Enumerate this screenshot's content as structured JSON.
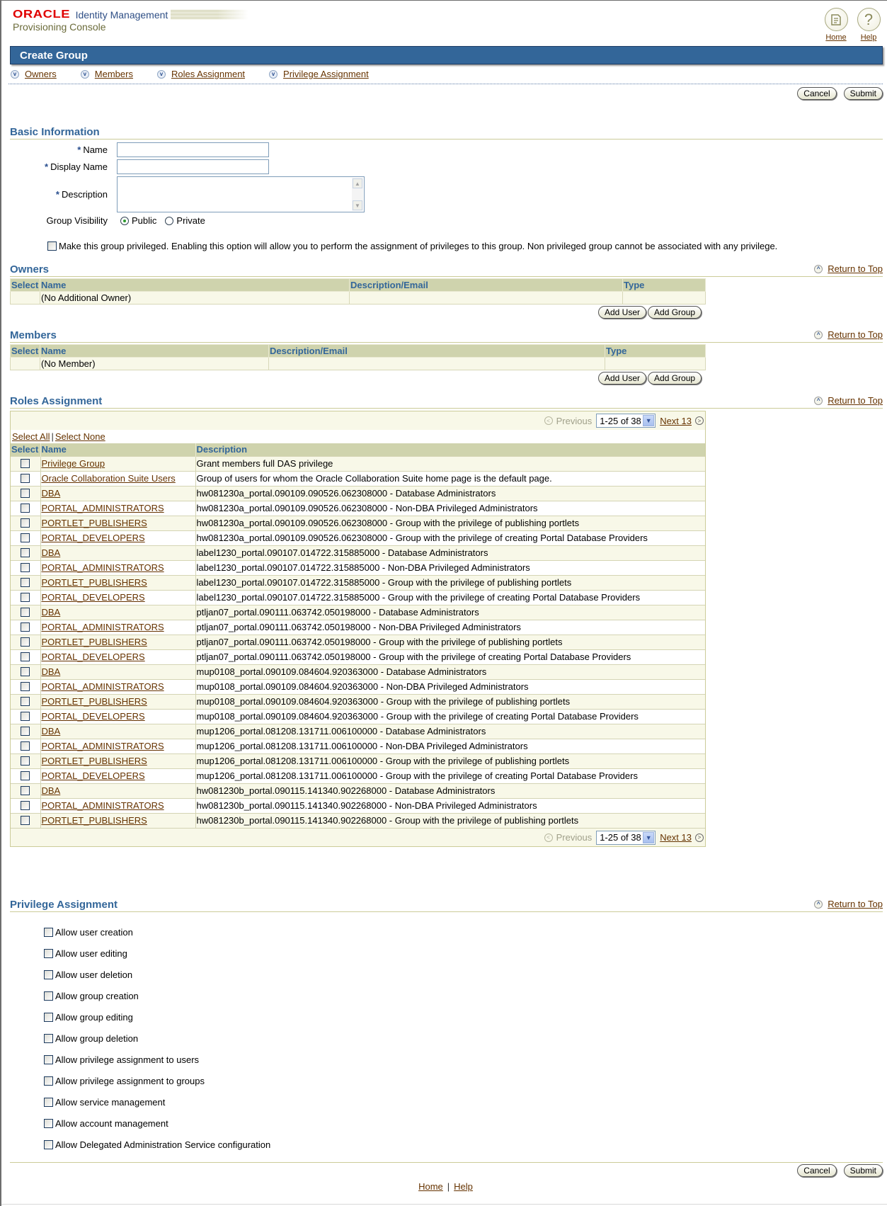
{
  "header": {
    "brand": "ORACLE",
    "product": "Identity Management",
    "subtitle": "Provisioning Console",
    "global_links": [
      {
        "label": "Home",
        "icon": "home-icon"
      },
      {
        "label": "Help",
        "icon": "help-icon"
      }
    ]
  },
  "page_title": "Create Group",
  "quick_links": [
    "Owners",
    "Members",
    "Roles Assignment",
    "Privilege Assignment"
  ],
  "actions": {
    "cancel": "Cancel",
    "submit": "Submit"
  },
  "basic_info": {
    "title": "Basic Information",
    "required_mark": "*",
    "name_label": "Name",
    "name_value": "",
    "display_name_label": "Display Name",
    "display_name_value": "",
    "description_label": "Description",
    "description_value": "",
    "visibility_label": "Group Visibility",
    "visibility_options": [
      "Public",
      "Private"
    ],
    "visibility_selected": "Public",
    "privileged_label": "Make this group privileged. Enabling this option will allow you to perform the assignment of privileges to this group. Non privileged group cannot be associated with any privilege.",
    "privileged_checked": false
  },
  "return_to_top": "Return to Top",
  "owners": {
    "title": "Owners",
    "columns": [
      "Select",
      "Name",
      "Description/Email",
      "Type"
    ],
    "empty_text": "(No Additional Owner)",
    "add_user": "Add User",
    "add_group": "Add Group"
  },
  "members": {
    "title": "Members",
    "columns": [
      "Select",
      "Name",
      "Description/Email",
      "Type"
    ],
    "empty_text": "(No Member)",
    "add_user": "Add User",
    "add_group": "Add Group"
  },
  "roles": {
    "title": "Roles Assignment",
    "pager": {
      "previous": "Previous",
      "range": "1-25 of 38",
      "next": "Next 13"
    },
    "select_all": "Select All",
    "select_none": "Select None",
    "columns": [
      "Select",
      "Name",
      "Description"
    ],
    "rows": [
      {
        "name": "Privilege Group",
        "description": "Grant members full DAS privilege"
      },
      {
        "name": "Oracle Collaboration Suite Users",
        "description": "Group of users for whom the Oracle Collaboration Suite home page is the default page."
      },
      {
        "name": "DBA",
        "description": "hw081230a_portal.090109.090526.062308000 - Database Administrators"
      },
      {
        "name": "PORTAL_ADMINISTRATORS",
        "description": "hw081230a_portal.090109.090526.062308000 - Non-DBA Privileged Administrators"
      },
      {
        "name": "PORTLET_PUBLISHERS",
        "description": "hw081230a_portal.090109.090526.062308000 - Group with the privilege of publishing portlets"
      },
      {
        "name": "PORTAL_DEVELOPERS",
        "description": "hw081230a_portal.090109.090526.062308000 - Group with the privilege of creating Portal Database Providers"
      },
      {
        "name": "DBA",
        "description": "label1230_portal.090107.014722.315885000 - Database Administrators"
      },
      {
        "name": "PORTAL_ADMINISTRATORS",
        "description": "label1230_portal.090107.014722.315885000 - Non-DBA Privileged Administrators"
      },
      {
        "name": "PORTLET_PUBLISHERS",
        "description": "label1230_portal.090107.014722.315885000 - Group with the privilege of publishing portlets"
      },
      {
        "name": "PORTAL_DEVELOPERS",
        "description": "label1230_portal.090107.014722.315885000 - Group with the privilege of creating Portal Database Providers"
      },
      {
        "name": "DBA",
        "description": "ptljan07_portal.090111.063742.050198000 - Database Administrators"
      },
      {
        "name": "PORTAL_ADMINISTRATORS",
        "description": "ptljan07_portal.090111.063742.050198000 - Non-DBA Privileged Administrators"
      },
      {
        "name": "PORTLET_PUBLISHERS",
        "description": "ptljan07_portal.090111.063742.050198000 - Group with the privilege of publishing portlets"
      },
      {
        "name": "PORTAL_DEVELOPERS",
        "description": "ptljan07_portal.090111.063742.050198000 - Group with the privilege of creating Portal Database Providers"
      },
      {
        "name": "DBA",
        "description": "mup0108_portal.090109.084604.920363000 - Database Administrators"
      },
      {
        "name": "PORTAL_ADMINISTRATORS",
        "description": "mup0108_portal.090109.084604.920363000 - Non-DBA Privileged Administrators"
      },
      {
        "name": "PORTLET_PUBLISHERS",
        "description": "mup0108_portal.090109.084604.920363000 - Group with the privilege of publishing portlets"
      },
      {
        "name": "PORTAL_DEVELOPERS",
        "description": "mup0108_portal.090109.084604.920363000 - Group with the privilege of creating Portal Database Providers"
      },
      {
        "name": "DBA",
        "description": "mup1206_portal.081208.131711.006100000 - Database Administrators"
      },
      {
        "name": "PORTAL_ADMINISTRATORS",
        "description": "mup1206_portal.081208.131711.006100000 - Non-DBA Privileged Administrators"
      },
      {
        "name": "PORTLET_PUBLISHERS",
        "description": "mup1206_portal.081208.131711.006100000 - Group with the privilege of publishing portlets"
      },
      {
        "name": "PORTAL_DEVELOPERS",
        "description": "mup1206_portal.081208.131711.006100000 - Group with the privilege of creating Portal Database Providers"
      },
      {
        "name": "DBA",
        "description": "hw081230b_portal.090115.141340.902268000 - Database Administrators"
      },
      {
        "name": "PORTAL_ADMINISTRATORS",
        "description": "hw081230b_portal.090115.141340.902268000 - Non-DBA Privileged Administrators"
      },
      {
        "name": "PORTLET_PUBLISHERS",
        "description": "hw081230b_portal.090115.141340.902268000 - Group with the privilege of publishing portlets"
      }
    ]
  },
  "privileges": {
    "title": "Privilege Assignment",
    "items": [
      "Allow user creation",
      "Allow user editing",
      "Allow user deletion",
      "Allow group creation",
      "Allow group editing",
      "Allow group deletion",
      "Allow privilege assignment to users",
      "Allow privilege assignment to groups",
      "Allow service management",
      "Allow account management",
      "Allow Delegated Administration Service configuration"
    ]
  },
  "footer": {
    "home": "Home",
    "help": "Help",
    "separator": "|"
  },
  "colors": {
    "title_bar": "#336699",
    "section_title": "#336699",
    "link": "#663300",
    "table_header": "#cfd3ad",
    "table_row": "#f8f8e8",
    "brand_red": "#e00000"
  }
}
